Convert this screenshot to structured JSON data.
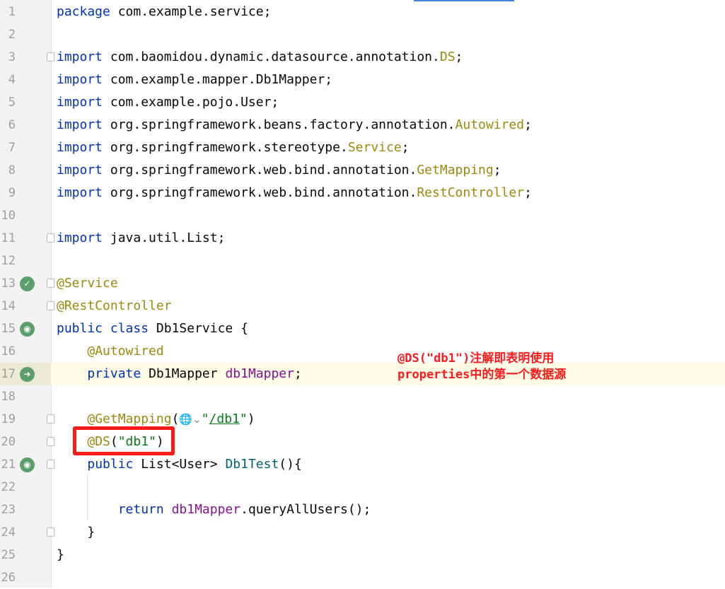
{
  "editor": {
    "lines": [
      {
        "num": "1",
        "tokens": [
          {
            "t": "package ",
            "c": "kw"
          },
          {
            "t": "com.example.service;",
            "c": "plain"
          }
        ]
      },
      {
        "num": "2",
        "tokens": []
      },
      {
        "num": "3",
        "fold": true,
        "tokens": [
          {
            "t": "import ",
            "c": "kw"
          },
          {
            "t": "com.baomidou.dynamic.datasource.annotation.",
            "c": "plain"
          },
          {
            "t": "DS",
            "c": "ann"
          },
          {
            "t": ";",
            "c": "plain"
          }
        ]
      },
      {
        "num": "4",
        "tokens": [
          {
            "t": "import ",
            "c": "kw"
          },
          {
            "t": "com.example.mapper.Db1Mapper;",
            "c": "plain"
          }
        ]
      },
      {
        "num": "5",
        "tokens": [
          {
            "t": "import ",
            "c": "kw"
          },
          {
            "t": "com.example.pojo.User;",
            "c": "plain"
          }
        ]
      },
      {
        "num": "6",
        "tokens": [
          {
            "t": "import ",
            "c": "kw"
          },
          {
            "t": "org.springframework.beans.factory.annotation.",
            "c": "plain"
          },
          {
            "t": "Autowired",
            "c": "ann"
          },
          {
            "t": ";",
            "c": "plain"
          }
        ]
      },
      {
        "num": "7",
        "tokens": [
          {
            "t": "import ",
            "c": "kw"
          },
          {
            "t": "org.springframework.stereotype.",
            "c": "plain"
          },
          {
            "t": "Service",
            "c": "ann"
          },
          {
            "t": ";",
            "c": "plain"
          }
        ]
      },
      {
        "num": "8",
        "tokens": [
          {
            "t": "import ",
            "c": "kw"
          },
          {
            "t": "org.springframework.web.bind.annotation.",
            "c": "plain"
          },
          {
            "t": "GetMapping",
            "c": "ann"
          },
          {
            "t": ";",
            "c": "plain"
          }
        ]
      },
      {
        "num": "9",
        "tokens": [
          {
            "t": "import ",
            "c": "kw"
          },
          {
            "t": "org.springframework.web.bind.annotation.",
            "c": "plain"
          },
          {
            "t": "RestController",
            "c": "ann"
          },
          {
            "t": ";",
            "c": "plain"
          }
        ]
      },
      {
        "num": "10",
        "tokens": []
      },
      {
        "num": "11",
        "fold": true,
        "tokens": [
          {
            "t": "import ",
            "c": "kw"
          },
          {
            "t": "java.util.List;",
            "c": "plain"
          }
        ]
      },
      {
        "num": "12",
        "tokens": []
      },
      {
        "num": "13",
        "fold": true,
        "icon": "✓",
        "iconName": "spring-bean-icon",
        "tokens": [
          {
            "t": "@Service",
            "c": "ann"
          }
        ]
      },
      {
        "num": "14",
        "fold": true,
        "tokens": [
          {
            "t": "@RestController",
            "c": "ann"
          }
        ]
      },
      {
        "num": "15",
        "icon": "◉",
        "iconName": "spring-web-icon",
        "tokens": [
          {
            "t": "public ",
            "c": "kw"
          },
          {
            "t": "class ",
            "c": "kw"
          },
          {
            "t": "Db1Service {",
            "c": "plain"
          }
        ]
      },
      {
        "num": "16",
        "tokens": [
          {
            "t": "    ",
            "c": "plain"
          },
          {
            "t": "@Autowired",
            "c": "ann"
          }
        ]
      },
      {
        "num": "17",
        "current": true,
        "icon": "➜",
        "iconName": "autowired-navigate-icon",
        "tokens": [
          {
            "t": "    ",
            "c": "plain"
          },
          {
            "t": "private ",
            "c": "kw"
          },
          {
            "t": "Db1Mapper ",
            "c": "plain"
          },
          {
            "t": "db1Mapper",
            "c": "fld"
          },
          {
            "t": ";",
            "c": "plain"
          }
        ]
      },
      {
        "num": "18",
        "tokens": []
      },
      {
        "num": "19",
        "fold": true,
        "tokens": [
          {
            "t": "    ",
            "c": "plain"
          },
          {
            "t": "@GetMapping",
            "c": "ann"
          },
          {
            "t": "(",
            "c": "plain"
          },
          {
            "t": "🌐⌄",
            "c": "globe"
          },
          {
            "t": "\"",
            "c": "str"
          },
          {
            "t": "/db1",
            "c": "str url-underline"
          },
          {
            "t": "\"",
            "c": "str"
          },
          {
            "t": ")",
            "c": "plain"
          }
        ]
      },
      {
        "num": "20",
        "fold": true,
        "tokens": [
          {
            "t": "    ",
            "c": "plain"
          },
          {
            "t": "@DS",
            "c": "ann"
          },
          {
            "t": "(",
            "c": "plain"
          },
          {
            "t": "\"db1\"",
            "c": "str"
          },
          {
            "t": ")",
            "c": "plain"
          }
        ]
      },
      {
        "num": "21",
        "fold": true,
        "icon": "◉",
        "iconName": "endpoint-icon",
        "tokens": [
          {
            "t": "    ",
            "c": "plain"
          },
          {
            "t": "public ",
            "c": "kw"
          },
          {
            "t": "List<User> ",
            "c": "plain"
          },
          {
            "t": "Db1Test",
            "c": "mth"
          },
          {
            "t": "(){",
            "c": "plain"
          }
        ]
      },
      {
        "num": "22",
        "tokens": []
      },
      {
        "num": "23",
        "tokens": [
          {
            "t": "        ",
            "c": "plain"
          },
          {
            "t": "return ",
            "c": "kw"
          },
          {
            "t": "db1Mapper",
            "c": "fld"
          },
          {
            "t": ".queryAllUsers();",
            "c": "plain"
          }
        ]
      },
      {
        "num": "24",
        "fold": true,
        "tokens": [
          {
            "t": "    }",
            "c": "plain"
          }
        ]
      },
      {
        "num": "25",
        "tokens": [
          {
            "t": "}",
            "c": "plain"
          }
        ]
      },
      {
        "num": "26",
        "tokens": []
      }
    ]
  },
  "annotation_note": {
    "line1": "@DS(\"db1\")注解即表明使用",
    "line2": "properties中的第一个数据源"
  },
  "colors": {
    "keyword": "#0033b3",
    "annotation": "#9e880d",
    "field": "#871094",
    "string": "#067d17",
    "method": "#00627a",
    "highlight": "#ff1a1a"
  }
}
